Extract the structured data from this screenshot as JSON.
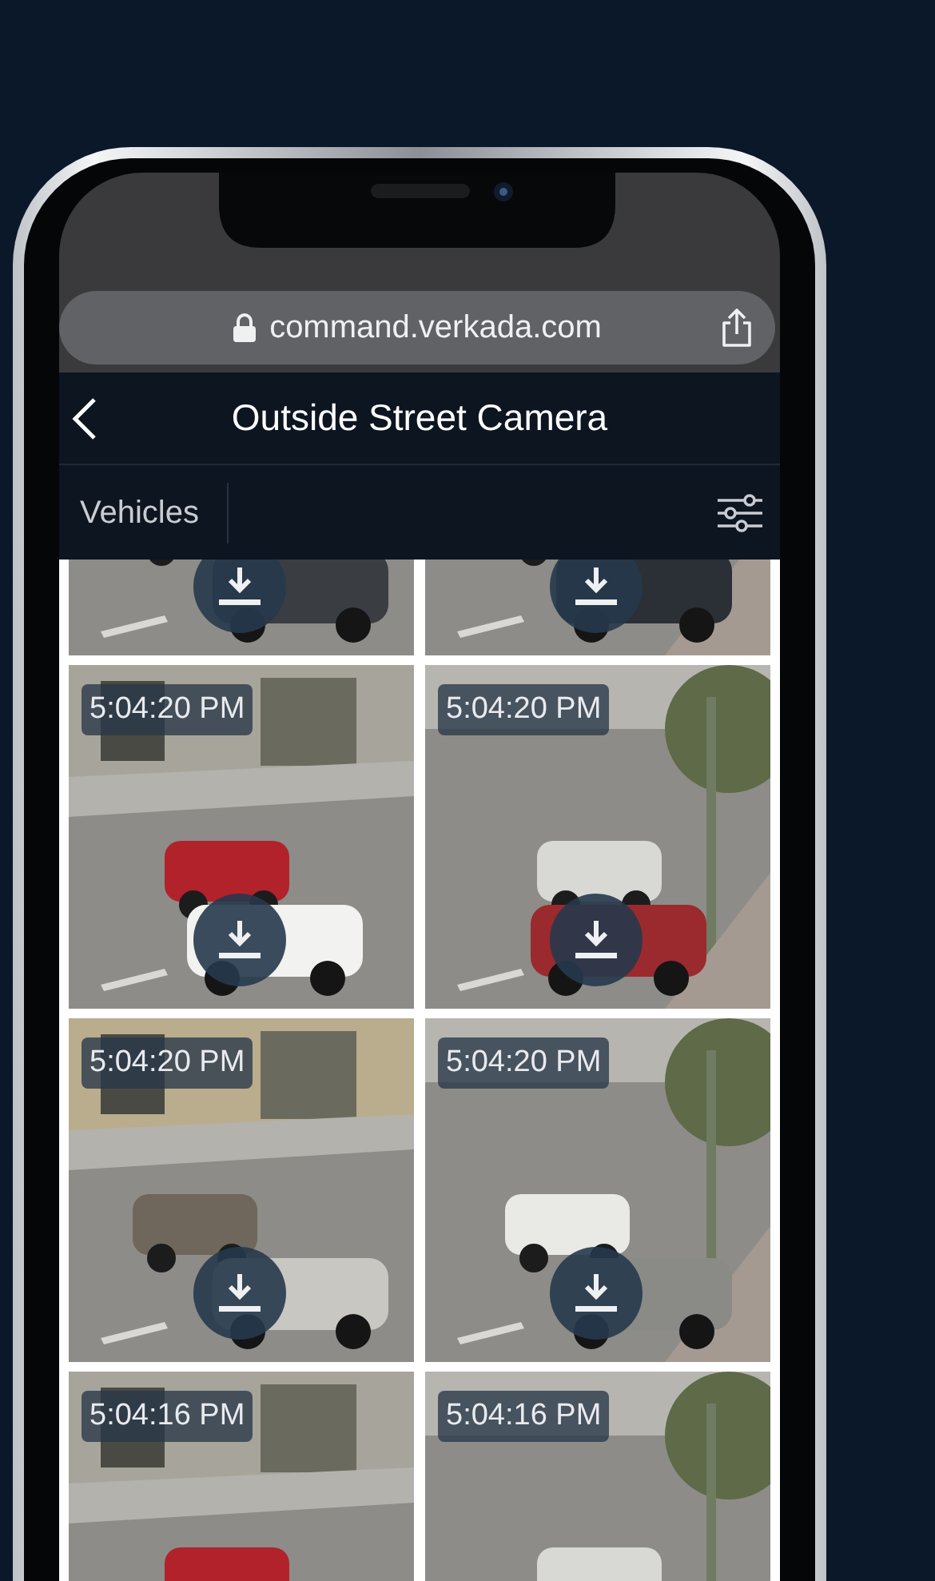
{
  "browser": {
    "url": "command.verkada.com"
  },
  "header": {
    "title": "Outside Street Camera"
  },
  "filter_bar": {
    "label": "Vehicles"
  },
  "clips": [
    {
      "kind": "picture"
    },
    {
      "kind": "picture"
    },
    {
      "kind": "picture",
      "timestamp": "5:04:20 PM"
    },
    {
      "kind": "picture",
      "timestamp": "5:04:20 PM"
    },
    {
      "kind": "picture",
      "timestamp": "5:04:20 PM"
    },
    {
      "kind": "picture",
      "timestamp": "5:04:20 PM"
    },
    {
      "kind": "picture",
      "timestamp": "5:04:16 PM"
    },
    {
      "kind": "picture",
      "timestamp": "5:04:16 PM"
    }
  ]
}
